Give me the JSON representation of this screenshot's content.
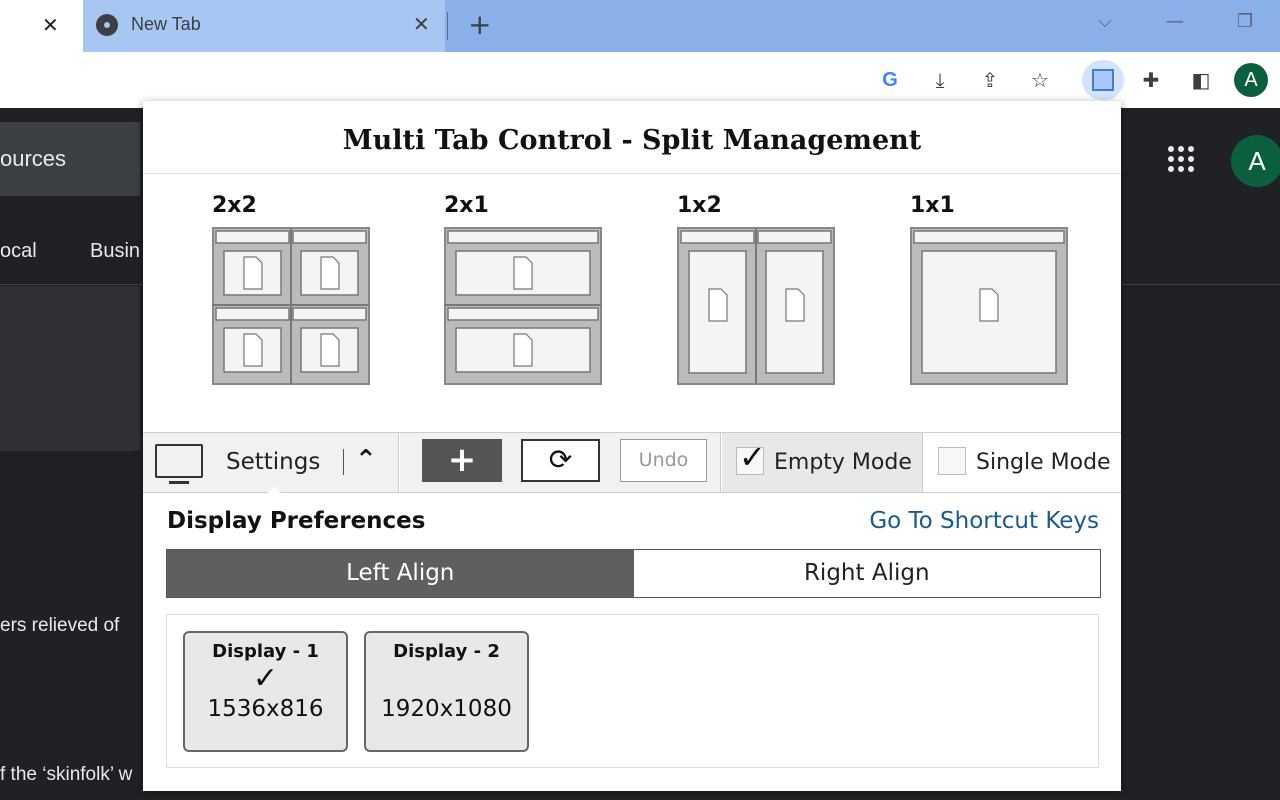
{
  "browser": {
    "prev_tab_close": "✕",
    "tab_title": "New Tab",
    "tab_close": "✕",
    "new_tab": "+",
    "window": {
      "dropdown": "⌵",
      "minimize": "—",
      "restore": "❐"
    },
    "toolbar": {
      "google_icon": "G",
      "install_icon": "⤓",
      "share_icon": "⇪",
      "bookmark_icon": "☆",
      "extensions_icon": "✚",
      "sidepanel_icon": "◧",
      "avatar": "A"
    }
  },
  "background_page": {
    "resources_label": "ources",
    "nav_local": "ocal",
    "nav_business": "Busin",
    "snippet1": "ers relieved of",
    "snippet2": "f the ‘skinfolk’ w",
    "avatar": "A"
  },
  "popup": {
    "title": "Multi Tab Control - Split Management",
    "layouts": [
      {
        "label": "2x2"
      },
      {
        "label": "2x1"
      },
      {
        "label": "1x2"
      },
      {
        "label": "1x1"
      }
    ],
    "controls": {
      "settings_label": "Settings",
      "collapse_icon": "⌃",
      "add_label": "+",
      "refresh_label": "⟳",
      "undo_label": "Undo",
      "empty_mode_label": "Empty Mode",
      "empty_mode_checked": true,
      "single_mode_label": "Single Mode",
      "single_mode_checked": false,
      "checkmark": "✓"
    },
    "preferences": {
      "title": "Display Preferences",
      "shortcut_link": "Go To Shortcut Keys",
      "align_left": "Left Align",
      "align_right": "Right Align",
      "selected_align": "left"
    },
    "displays": [
      {
        "name": "Display - 1",
        "resolution": "1536x816",
        "selected": true,
        "check": "✓"
      },
      {
        "name": "Display - 2",
        "resolution": "1920x1080",
        "selected": false,
        "check": ""
      }
    ]
  }
}
